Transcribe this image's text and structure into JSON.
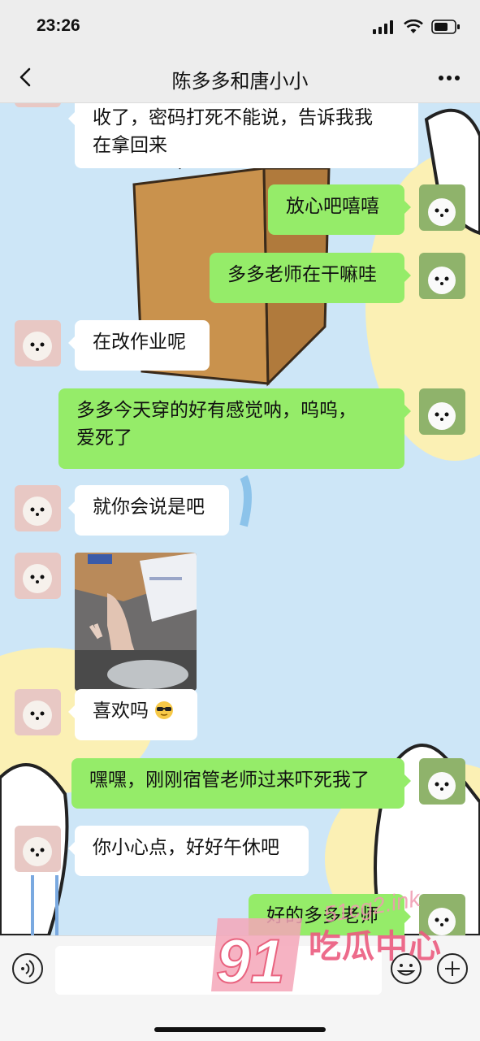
{
  "status_bar": {
    "time": "23:26"
  },
  "header": {
    "title": "陈多多和唐小小"
  },
  "messages": [
    {
      "side": "in",
      "text": "收了，密码打死不能说，告诉我我在拿回来",
      "lines": [
        "收了，密码打死不能说，告诉我我",
        "在拿回来"
      ]
    },
    {
      "side": "out",
      "text": "放心吧嘻嘻"
    },
    {
      "side": "out",
      "text": "多多老师在干嘛哇"
    },
    {
      "side": "in",
      "text": "在改作业呢"
    },
    {
      "side": "out",
      "text": "多多今天穿的好有感觉呐，呜呜，爱死了",
      "lines": [
        "多多今天穿的好有感觉呐，呜呜，",
        "爱死了"
      ]
    },
    {
      "side": "in",
      "text": "就你会说是吧"
    },
    {
      "side": "in",
      "type": "image"
    },
    {
      "side": "in",
      "text": "喜欢吗",
      "emoji": "sunglasses-face"
    },
    {
      "side": "out",
      "text": "嘿嘿，刚刚宿管老师过来吓死我了"
    },
    {
      "side": "in",
      "text": "你小心点，好好午休吧"
    },
    {
      "side": "out",
      "text": "好的多多老师"
    }
  ],
  "input": {
    "placeholder": ""
  },
  "watermark": {
    "number": "91",
    "brand": "吃瓜中心",
    "url": "51cg2.ink"
  },
  "colors": {
    "outgoing_bubble": "#95ec69",
    "incoming_bubble": "#ffffff",
    "bar_bg": "#ededed"
  },
  "icons": [
    "back-icon",
    "more-icon",
    "voice-icon",
    "emoji-icon",
    "plus-icon",
    "signal-icon",
    "wifi-icon",
    "battery-icon"
  ]
}
